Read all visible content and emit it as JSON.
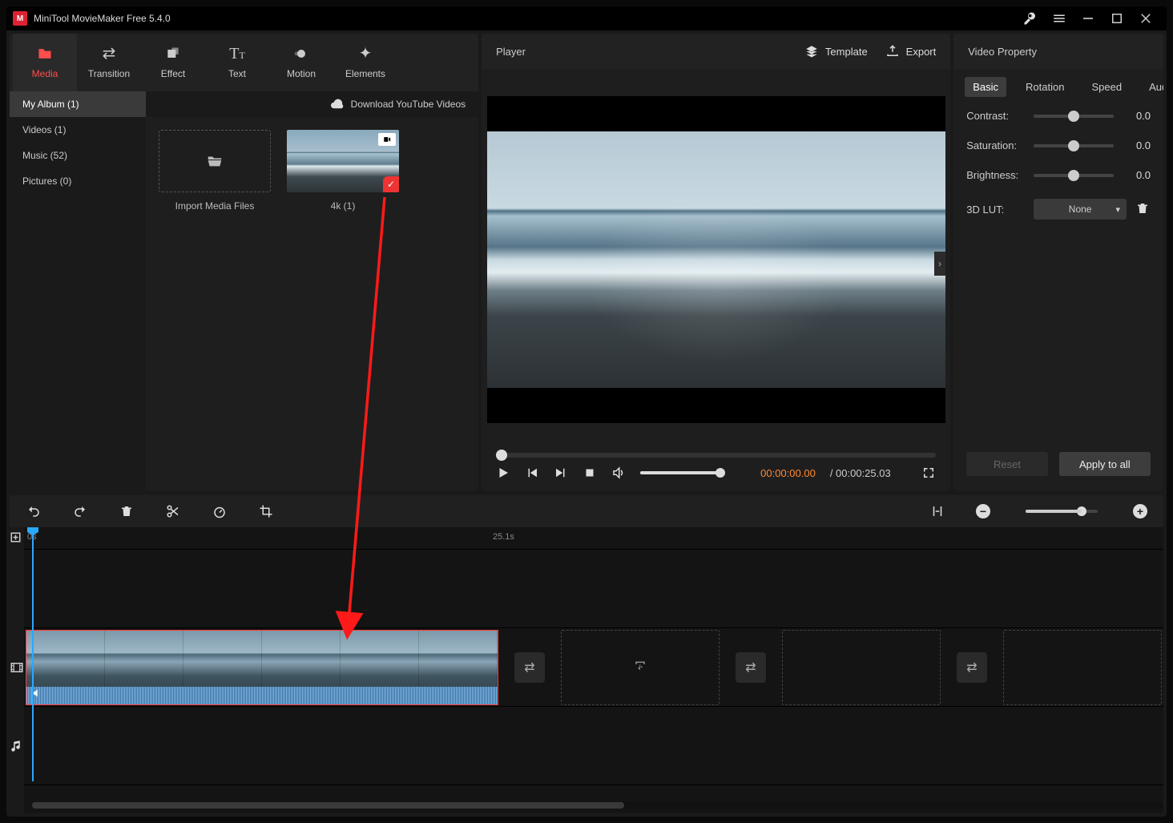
{
  "titlebar": {
    "title": "MiniTool MovieMaker Free 5.4.0"
  },
  "toolTabs": {
    "media": {
      "label": "Media"
    },
    "transition": {
      "label": "Transition"
    },
    "effect": {
      "label": "Effect"
    },
    "text": {
      "label": "Text"
    },
    "motion": {
      "label": "Motion"
    },
    "elements": {
      "label": "Elements"
    }
  },
  "mediaSide": {
    "album": {
      "label": "My Album (1)"
    },
    "videos": {
      "label": "Videos (1)"
    },
    "music": {
      "label": "Music (52)"
    },
    "pictures": {
      "label": "Pictures (0)"
    }
  },
  "mediaHeader": {
    "download": "Download YouTube Videos"
  },
  "mediaGrid": {
    "import": {
      "label": "Import Media Files"
    },
    "clip1": {
      "label": "4k (1)"
    }
  },
  "player": {
    "title": "Player",
    "template": "Template",
    "export": "Export",
    "current": "00:00:00.00",
    "duration": "/ 00:00:25.03"
  },
  "propPanel": {
    "title": "Video Property",
    "tabs": {
      "basic": "Basic",
      "rotation": "Rotation",
      "speed": "Speed",
      "audio": "Audio"
    },
    "contrast": {
      "label": "Contrast:",
      "value": "0.0"
    },
    "saturation": {
      "label": "Saturation:",
      "value": "0.0"
    },
    "brightness": {
      "label": "Brightness:",
      "value": "0.0"
    },
    "lut": {
      "label": "3D LUT:",
      "value": "None"
    },
    "reset": "Reset",
    "apply": "Apply to all"
  },
  "ruler": {
    "t0": "0s",
    "t1": "25.1s"
  }
}
